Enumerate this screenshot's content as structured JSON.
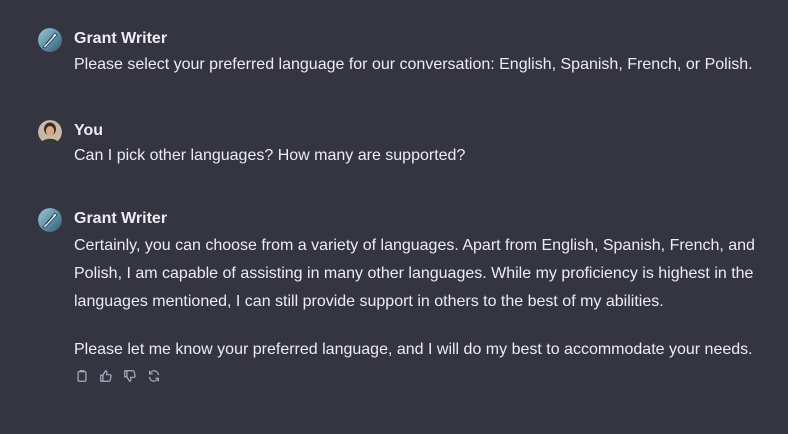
{
  "messages": [
    {
      "author": "Grant Writer",
      "avatar_icon": "feather-pen-avatar-icon",
      "paragraphs": [
        "Please select your preferred language for our conversation: English, Spanish, French, or Polish."
      ]
    },
    {
      "author": "You",
      "avatar_icon": "user-photo-avatar-icon",
      "paragraphs": [
        "Can I pick other languages? How many are supported?"
      ]
    },
    {
      "author": "Grant Writer",
      "avatar_icon": "feather-pen-avatar-icon",
      "paragraphs": [
        "Certainly, you can choose from a variety of languages. Apart from English, Spanish, French, and Polish, I am capable of assisting in many other languages. While my proficiency is highest in the languages mentioned, I can still provide support in others to the best of my abilities.",
        "Please let me know your preferred language, and I will do my best to accommodate your needs."
      ]
    }
  ],
  "action_icons": [
    "copy-icon",
    "thumbs-up-icon",
    "thumbs-down-icon",
    "regenerate-icon"
  ],
  "colors": {
    "background": "#343541",
    "text": "#ececf1",
    "icon": "#acacbe"
  }
}
